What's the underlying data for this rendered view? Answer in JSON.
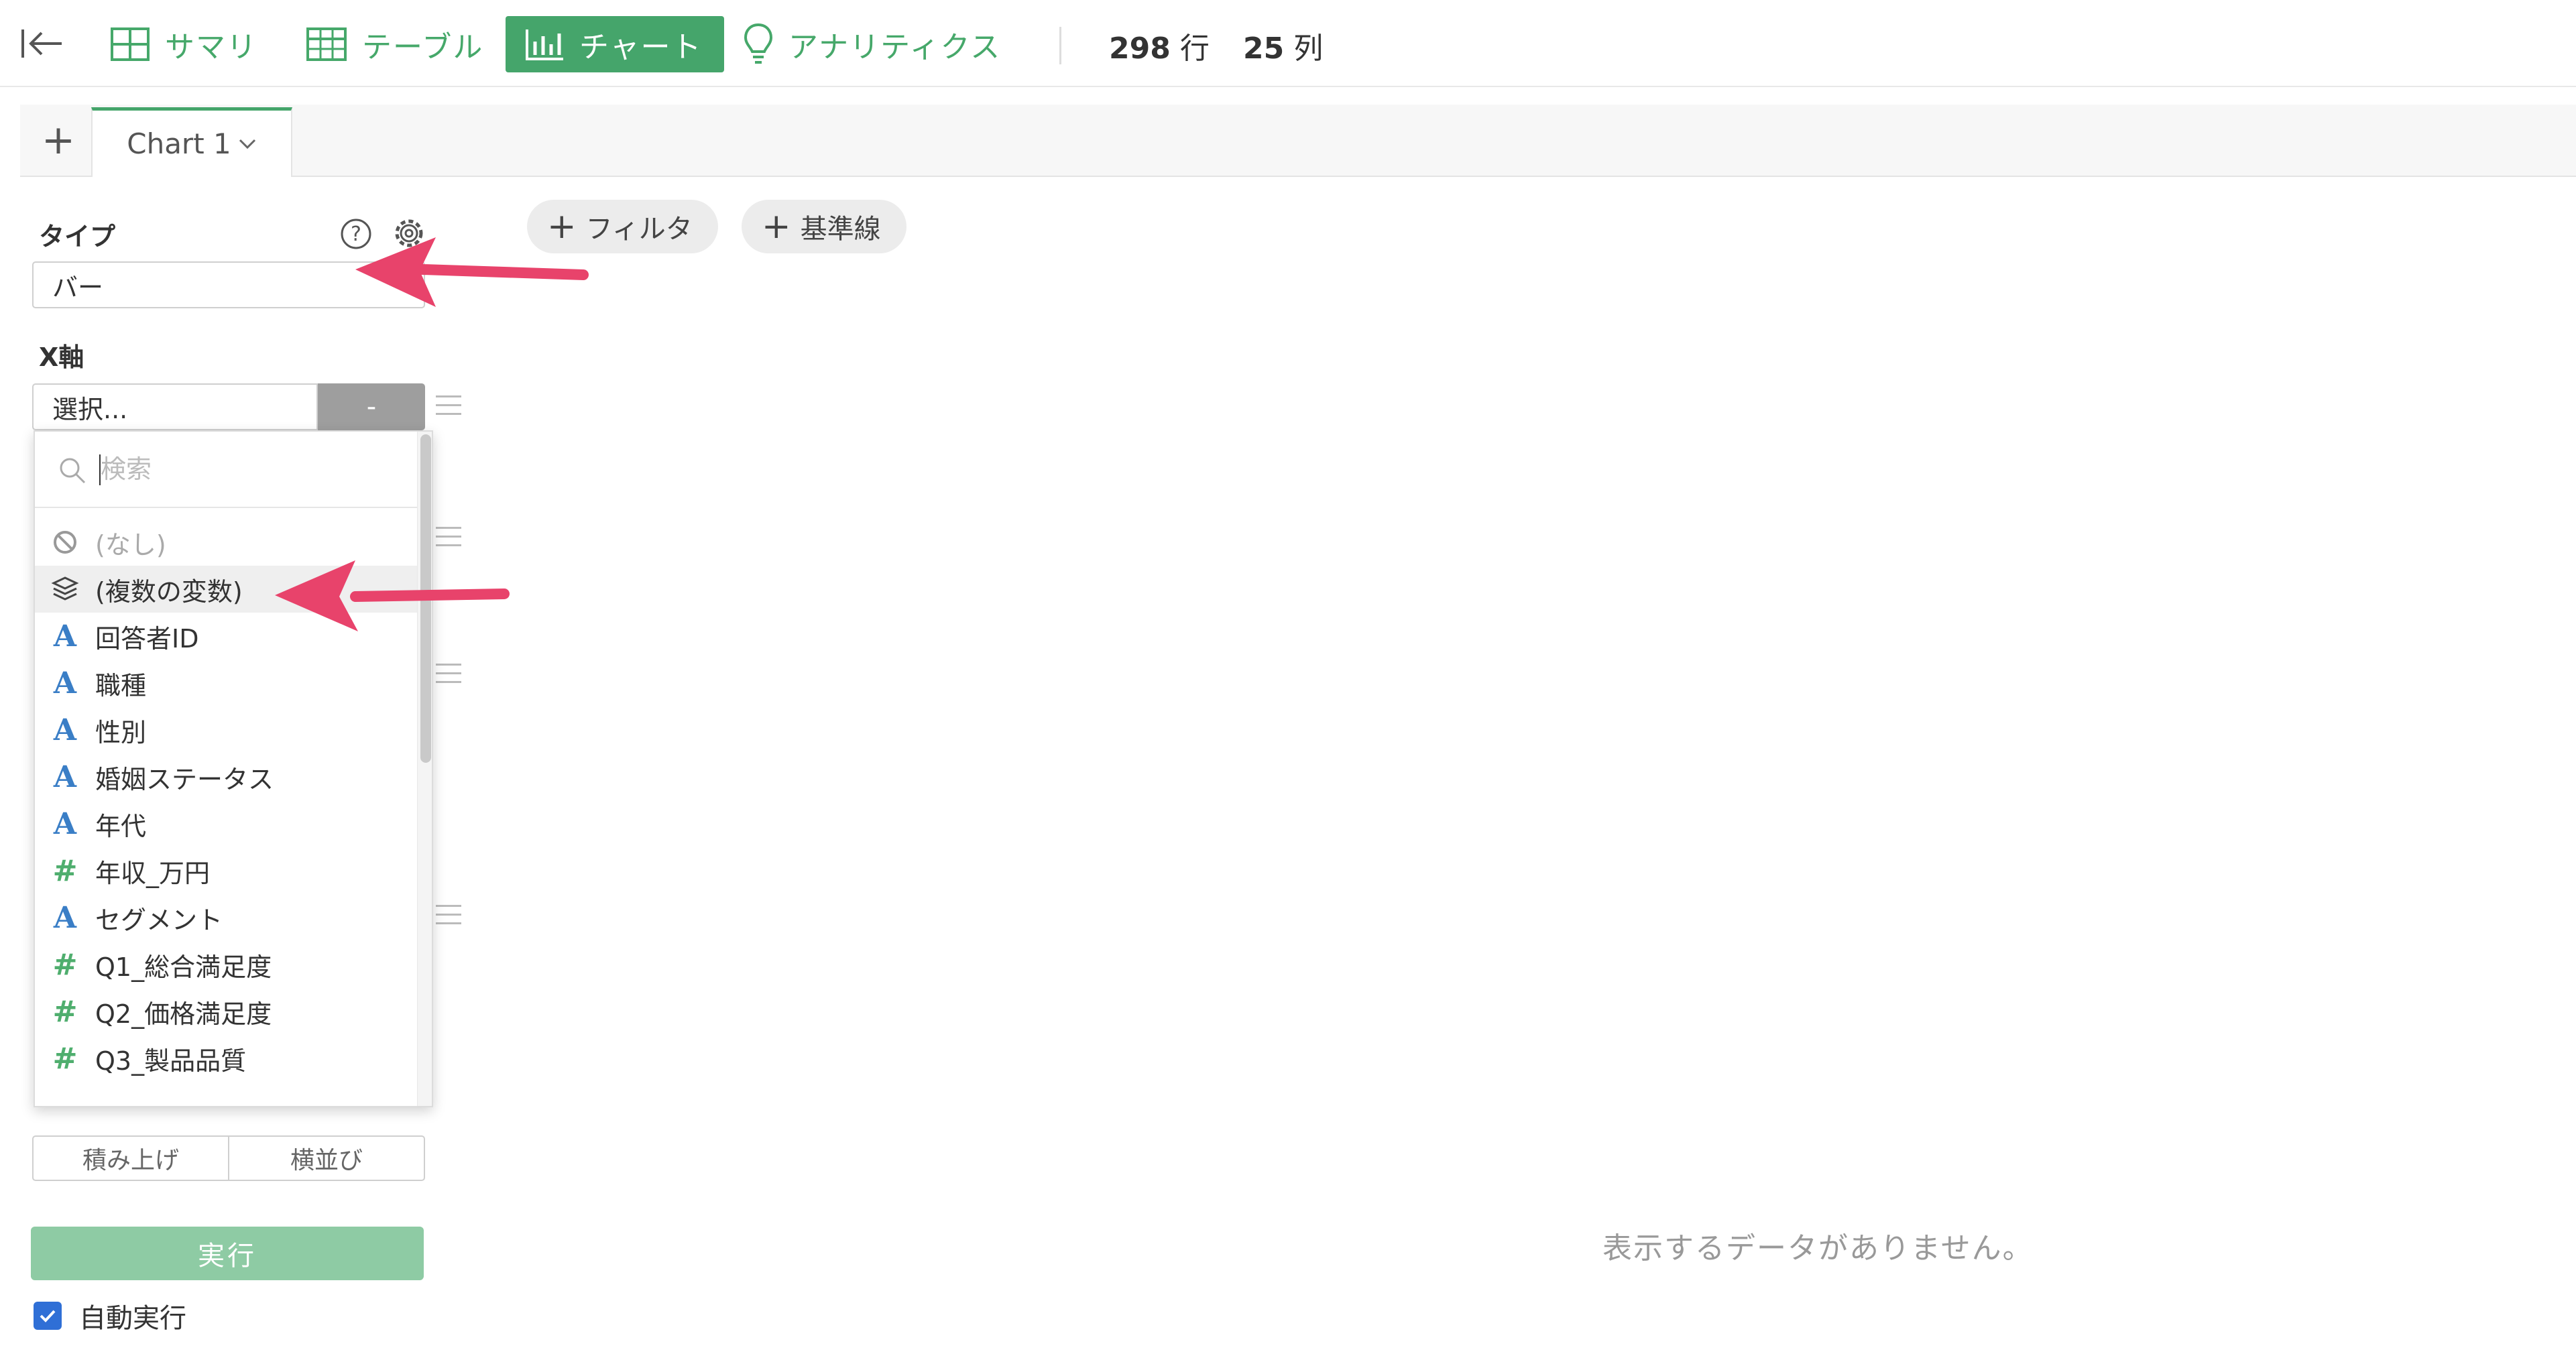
{
  "toolbar": {
    "tabs": [
      {
        "label": "サマリ",
        "icon": "grid-icon"
      },
      {
        "label": "テーブル",
        "icon": "table-icon"
      },
      {
        "label": "チャート",
        "icon": "bar-chart-icon"
      },
      {
        "label": "アナリティクス",
        "icon": "lightbulb-icon"
      }
    ],
    "rows_value": "298",
    "rows_unit": "行",
    "cols_value": "25",
    "cols_unit": "列"
  },
  "chart_tabs": {
    "add_label": "+",
    "active_tab": "Chart 1"
  },
  "filters": {
    "filter_label": "フィルタ",
    "reference_line_label": "基準線"
  },
  "panel": {
    "type_label": "タイプ",
    "type_value": "バー",
    "x_axis_label": "X軸",
    "x_axis_value": "選択...",
    "x_axis_button": "-",
    "dropdown": {
      "search_placeholder": "検索",
      "options": [
        {
          "label": "(なし)",
          "icon": "no-icon",
          "disabled": true
        },
        {
          "label": "(複数の変数)",
          "icon": "layers-icon",
          "highlighted": true
        },
        {
          "label": "回答者ID",
          "icon": "A"
        },
        {
          "label": "職種",
          "icon": "A"
        },
        {
          "label": "性別",
          "icon": "A"
        },
        {
          "label": "婚姻ステータス",
          "icon": "A"
        },
        {
          "label": "年代",
          "icon": "A"
        },
        {
          "label": "年収_万円",
          "icon": "#"
        },
        {
          "label": "セグメント",
          "icon": "A"
        },
        {
          "label": "Q1_総合満足度",
          "icon": "#"
        },
        {
          "label": "Q2_価格満足度",
          "icon": "#"
        },
        {
          "label": "Q3_製品品質",
          "icon": "#"
        }
      ]
    },
    "stack_label": "積み上げ",
    "side_by_side_label": "横並び",
    "run_label": "実行",
    "auto_run_label": "自動実行",
    "auto_run_checked": true
  },
  "main": {
    "no_data": "表示するデータがありません。"
  },
  "colors": {
    "accent": "#45a56b",
    "annotation_arrow": "#e8436b"
  }
}
